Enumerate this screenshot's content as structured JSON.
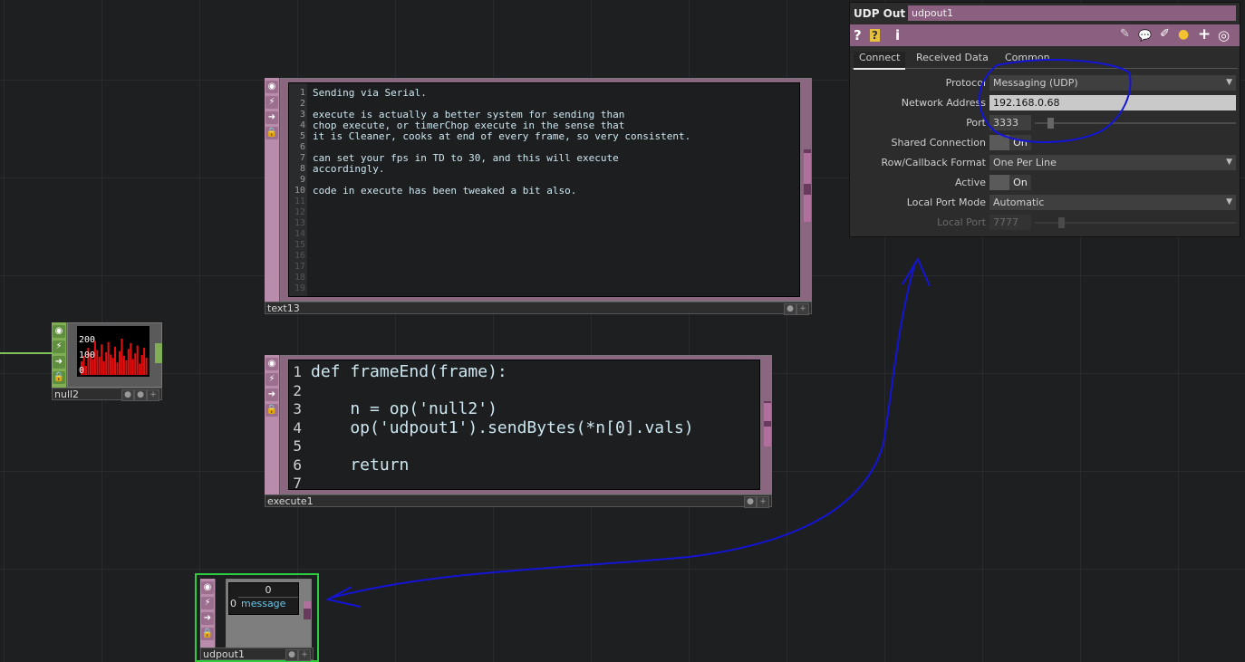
{
  "text13": {
    "name": "text13",
    "lines": [
      "Sending via Serial.",
      "",
      "execute is actually a better system for sending than",
      "chop execute, or timerChop execute in the sense that",
      "it is Cleaner, cooks at end of every frame, so very consistent.",
      "",
      "can set your fps in TD to 30, and this will execute",
      "accordingly.",
      "",
      "code in execute has been tweaked a bit also.",
      "",
      "",
      "",
      "",
      "",
      "",
      "",
      "",
      ""
    ],
    "line_numbers": [
      "1",
      "2",
      "3",
      "4",
      "5",
      "6",
      "7",
      "8",
      "9",
      "10",
      "11",
      "12",
      "13",
      "14",
      "15",
      "16",
      "17",
      "18",
      "19"
    ]
  },
  "execute1": {
    "name": "execute1",
    "lines": [
      "def frameEnd(frame):",
      "",
      "    n = op('null2')",
      "    op('udpout1').sendBytes(*n[0].vals)",
      "",
      "    return",
      ""
    ],
    "line_numbers": [
      "1",
      "2",
      "3",
      "4",
      "5",
      "6",
      "7"
    ]
  },
  "null2": {
    "name": "null2",
    "y_labels": [
      "200",
      "100",
      "0"
    ],
    "chart_data": {
      "type": "bar",
      "values": [
        60,
        85,
        40,
        120,
        95,
        70,
        150,
        110,
        80,
        135,
        60,
        100,
        145,
        90,
        75,
        125,
        55,
        105,
        160,
        85,
        65,
        115,
        140,
        70,
        95,
        130,
        50,
        88,
        120,
        76
      ],
      "ylim": [
        0,
        200
      ],
      "color": "#e01010"
    }
  },
  "udpout1": {
    "name": "udpout1",
    "header_value": "0",
    "row_index": "0",
    "row_value": "message"
  },
  "panel": {
    "type_title": "UDP Out",
    "op_name": "udpout1",
    "toolbar_icons": [
      "help-icon",
      "python-help-icon",
      "info-icon",
      "edit-icon",
      "comment-icon",
      "docked-icon",
      "python-icon",
      "add-icon",
      "target-icon"
    ],
    "toolbar_glyphs": {
      "help": "?",
      "pyhelp": "?",
      "info": "i",
      "edit": "✎",
      "comment": "💬",
      "docked": "✐",
      "python": "●",
      "add": "+",
      "target": "◎"
    },
    "tabs": [
      "Connect",
      "Received Data",
      "Common"
    ],
    "params": {
      "protocol": {
        "label": "Protocol",
        "value": "Messaging (UDP)"
      },
      "network_address": {
        "label": "Network Address",
        "value": "192.168.0.68"
      },
      "port": {
        "label": "Port",
        "value": "3333"
      },
      "shared_connection": {
        "label": "Shared Connection",
        "value": "On"
      },
      "row_callback_format": {
        "label": "Row/Callback Format",
        "value": "One Per Line"
      },
      "active": {
        "label": "Active",
        "value": "On"
      },
      "local_port_mode": {
        "label": "Local Port Mode",
        "value": "Automatic"
      },
      "local_port": {
        "label": "Local Port",
        "value": "7777"
      }
    }
  },
  "node_glyphs": {
    "viewer": "◉",
    "bypass": "⚡",
    "arrow": "➜",
    "lock": "🔒",
    "plus": "+"
  },
  "colors": {
    "dat_node": "#b98cab",
    "chop_node": "#7fae55",
    "selected_outline": "#2ecc40",
    "annotation_ink": "#1010d0",
    "panel_header": "#8b5f7f"
  }
}
